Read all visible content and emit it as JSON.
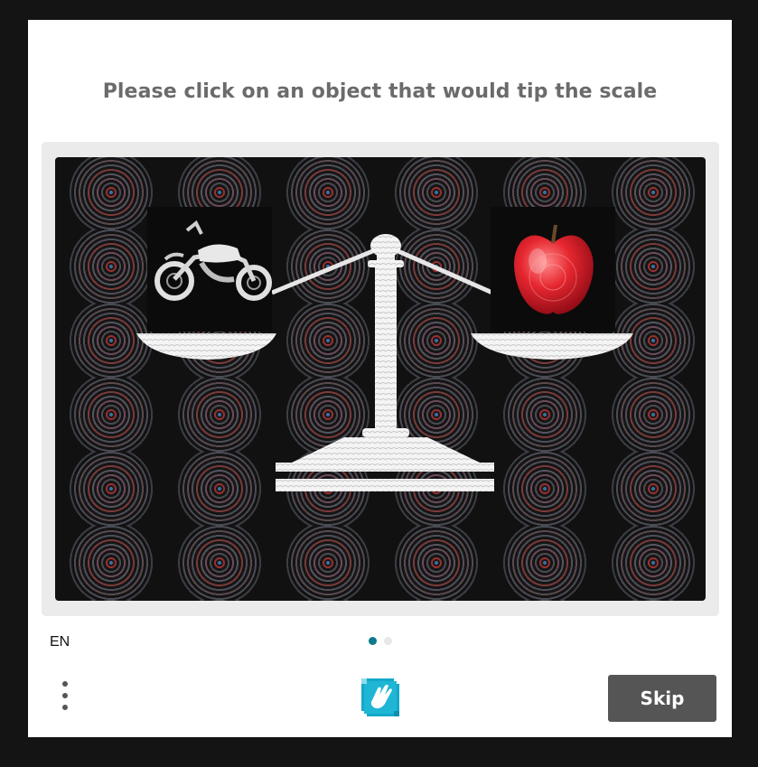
{
  "challenge": {
    "prompt": "Please click on an object that would tip the scale",
    "image_objects": [
      {
        "name": "motorcycle",
        "icon": "motorcycle-icon"
      },
      {
        "name": "apple",
        "icon": "apple-icon"
      }
    ],
    "pagination": {
      "total": 2,
      "current": 1,
      "active_color": "#0c7a8a",
      "inactive_color": "#e8e8e8"
    }
  },
  "footer": {
    "language": "EN",
    "menu_icon": "kebab-menu-icon",
    "logo_icon": "hand-wave-logo-icon",
    "skip_label": "Skip"
  },
  "colors": {
    "page_background": "#141414",
    "card_background": "#ffffff",
    "prompt_text": "#6b6b6b",
    "skip_button": "#555555",
    "logo_accent": "#1fb6d6"
  }
}
